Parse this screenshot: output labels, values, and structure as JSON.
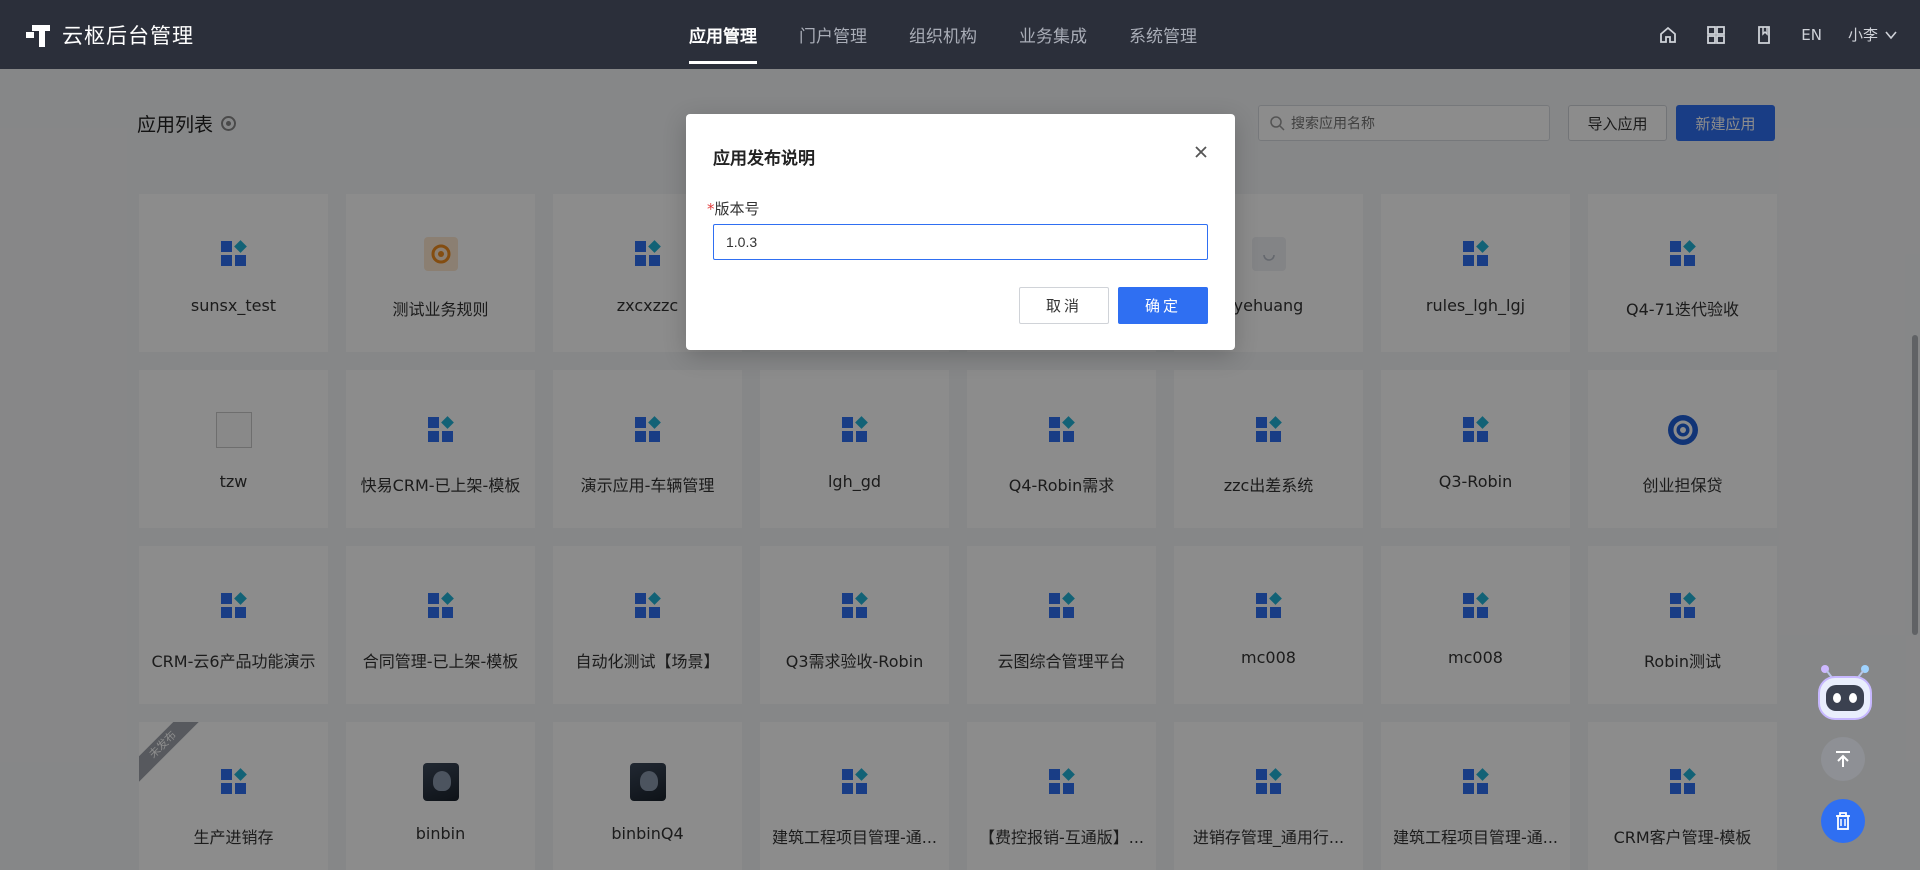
{
  "brand": {
    "title": "云枢后台管理"
  },
  "nav": {
    "items": [
      {
        "label": "应用管理",
        "active": true
      },
      {
        "label": "门户管理",
        "active": false
      },
      {
        "label": "组织机构",
        "active": false
      },
      {
        "label": "业务集成",
        "active": false
      },
      {
        "label": "系统管理",
        "active": false
      }
    ]
  },
  "header_tools": {
    "lang": "EN",
    "user": "小李"
  },
  "page": {
    "title": "应用列表",
    "search_placeholder": "搜索应用名称",
    "import_label": "导入应用",
    "new_label": "新建应用"
  },
  "apps": [
    {
      "name": "sunsx_test",
      "icon": "app-grid-icon"
    },
    {
      "name": "测试业务规则",
      "icon": "gear-orange-icon"
    },
    {
      "name": "zxcxzzc",
      "icon": "app-grid-icon"
    },
    {
      "name": "",
      "icon": "app-grid-icon"
    },
    {
      "name": "",
      "icon": "app-grid-icon"
    },
    {
      "name": "yehuang",
      "icon": "loading-icon"
    },
    {
      "name": "rules_lgh_lgj",
      "icon": "app-grid-icon"
    },
    {
      "name": "Q4-71迭代验收",
      "icon": "app-grid-icon"
    },
    {
      "name": "tzw",
      "icon": "broken-image-icon"
    },
    {
      "name": "快易CRM-已上架-模板",
      "icon": "app-grid-icon"
    },
    {
      "name": "演示应用-车辆管理",
      "icon": "app-grid-icon"
    },
    {
      "name": "lgh_gd",
      "icon": "app-grid-icon"
    },
    {
      "name": "Q4-Robin需求",
      "icon": "app-grid-icon"
    },
    {
      "name": "zzc出差系统",
      "icon": "app-grid-icon"
    },
    {
      "name": "Q3-Robin",
      "icon": "app-grid-icon"
    },
    {
      "name": "创业担保贷",
      "icon": "circle-logo-icon"
    },
    {
      "name": "CRM-云6产品功能演示",
      "icon": "app-grid-icon"
    },
    {
      "name": "合同管理-已上架-模板",
      "icon": "app-grid-icon"
    },
    {
      "name": "自动化测试【场景】",
      "icon": "app-grid-icon"
    },
    {
      "name": "Q3需求验收-Robin",
      "icon": "app-grid-icon"
    },
    {
      "name": "云图综合管理平台",
      "icon": "app-grid-icon"
    },
    {
      "name": "mc008",
      "icon": "app-grid-icon"
    },
    {
      "name": "mc008",
      "icon": "app-grid-icon"
    },
    {
      "name": "Robin测试",
      "icon": "app-grid-icon"
    },
    {
      "name": "生产进销存",
      "icon": "app-grid-icon",
      "ribbon": "未发布"
    },
    {
      "name": "binbin",
      "icon": "photo-icon"
    },
    {
      "name": "binbinQ4",
      "icon": "photo-icon"
    },
    {
      "name": "建筑工程项目管理-通...",
      "icon": "app-grid-icon"
    },
    {
      "name": "【费控报销-互通版】...",
      "icon": "app-grid-icon"
    },
    {
      "name": "进销存管理_通用行...",
      "icon": "app-grid-icon"
    },
    {
      "name": "建筑工程项目管理-通...",
      "icon": "app-grid-icon"
    },
    {
      "name": "CRM客户管理-模板",
      "icon": "app-grid-icon"
    }
  ],
  "modal": {
    "title": "应用发布说明",
    "required_mark": "*",
    "field_label": "版本号",
    "field_value": "1.0.3",
    "cancel_label": "取消",
    "ok_label": "确定"
  },
  "colors": {
    "primary": "#2f6ff2",
    "topbar": "#2b2f3a",
    "accent": "#22b2d8"
  }
}
